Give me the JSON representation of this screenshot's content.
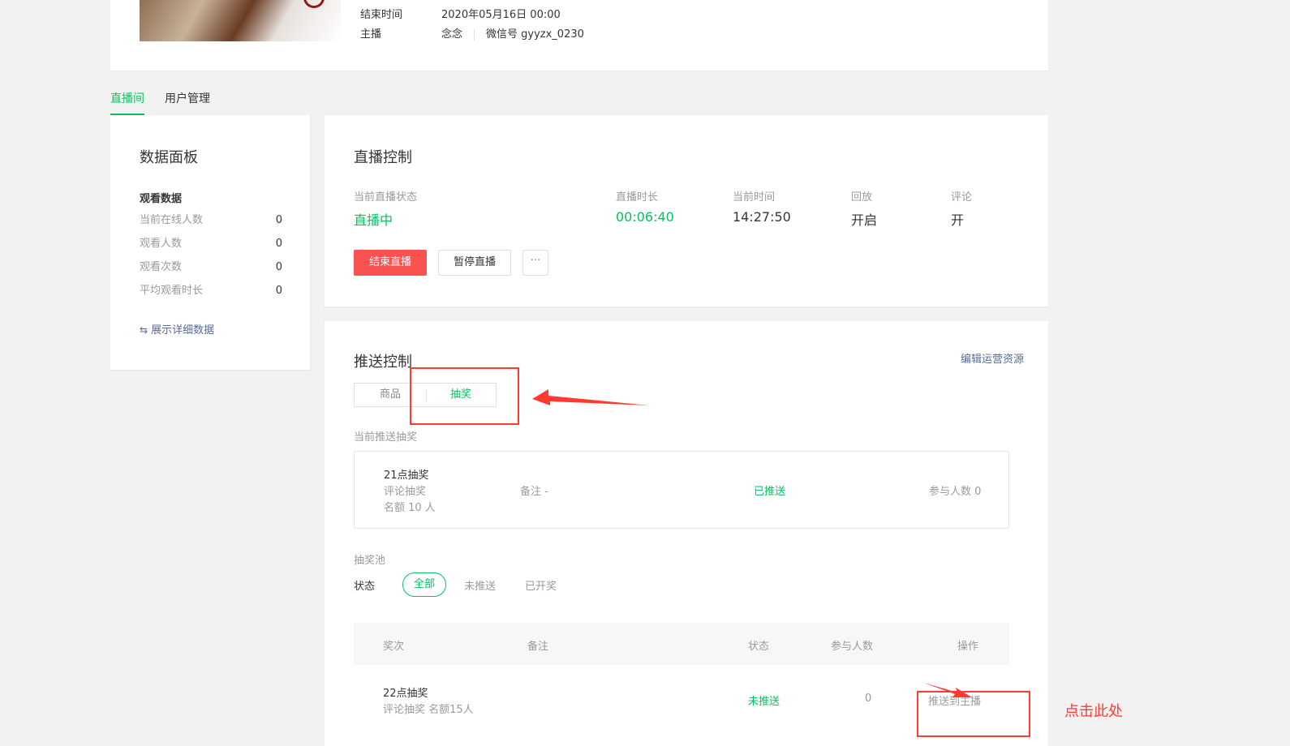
{
  "info": {
    "end_time_label": "结束时间",
    "end_time_value": "2020年05月16日 00:00",
    "host_label": "主播",
    "host_name": "念念",
    "host_wechat": "微信号 gyyzx_0230"
  },
  "tabs": [
    {
      "label": "直播间"
    },
    {
      "label": "用户管理"
    }
  ],
  "data_panel": {
    "title": "数据面板",
    "subtitle": "观看数据",
    "rows": [
      {
        "label": "当前在线人数",
        "value": "0"
      },
      {
        "label": "观看人数",
        "value": "0"
      },
      {
        "label": "观看次数",
        "value": "0"
      },
      {
        "label": "平均观看时长",
        "value": "0"
      }
    ],
    "link": "展示详细数据"
  },
  "live_control": {
    "title": "直播控制",
    "stats": [
      {
        "label": "当前直播状态",
        "value": "直播中"
      },
      {
        "label": "直播时长",
        "value": "00:06:40"
      },
      {
        "label": "当前时间",
        "value": "14:27:50"
      },
      {
        "label": "回放",
        "value": "开启"
      },
      {
        "label": "评论",
        "value": "开"
      }
    ],
    "end_button": "结束直播",
    "pause_button": "暂停直播",
    "more_button": "···"
  },
  "push_control": {
    "title": "推送控制",
    "edit_link": "编辑运营资源",
    "segments": [
      "商品",
      "抽奖"
    ],
    "current_label": "当前推送抽奖",
    "current": {
      "name": "21点抽奖",
      "type": "评论抽奖",
      "quota": "名额 10 人",
      "note": "备注 -",
      "status": "已推送",
      "participants": "参与人数 0"
    },
    "pool_label": "抽奖池",
    "status_label": "状态",
    "filters": [
      "全部",
      "未推送",
      "已开奖"
    ],
    "columns": [
      "奖次",
      "备注",
      "状态",
      "参与人数",
      "操作"
    ],
    "rows": [
      {
        "name": "22点抽奖",
        "desc": "评论抽奖 名额15人",
        "status": "未推送",
        "participants": "0",
        "action": "推送到主播"
      }
    ]
  },
  "annotation": {
    "click_here": "点击此处",
    "color": "#ff3b30"
  },
  "colors": {
    "accent": "#07c160",
    "danger": "#fa5151",
    "link": "#576b95"
  }
}
